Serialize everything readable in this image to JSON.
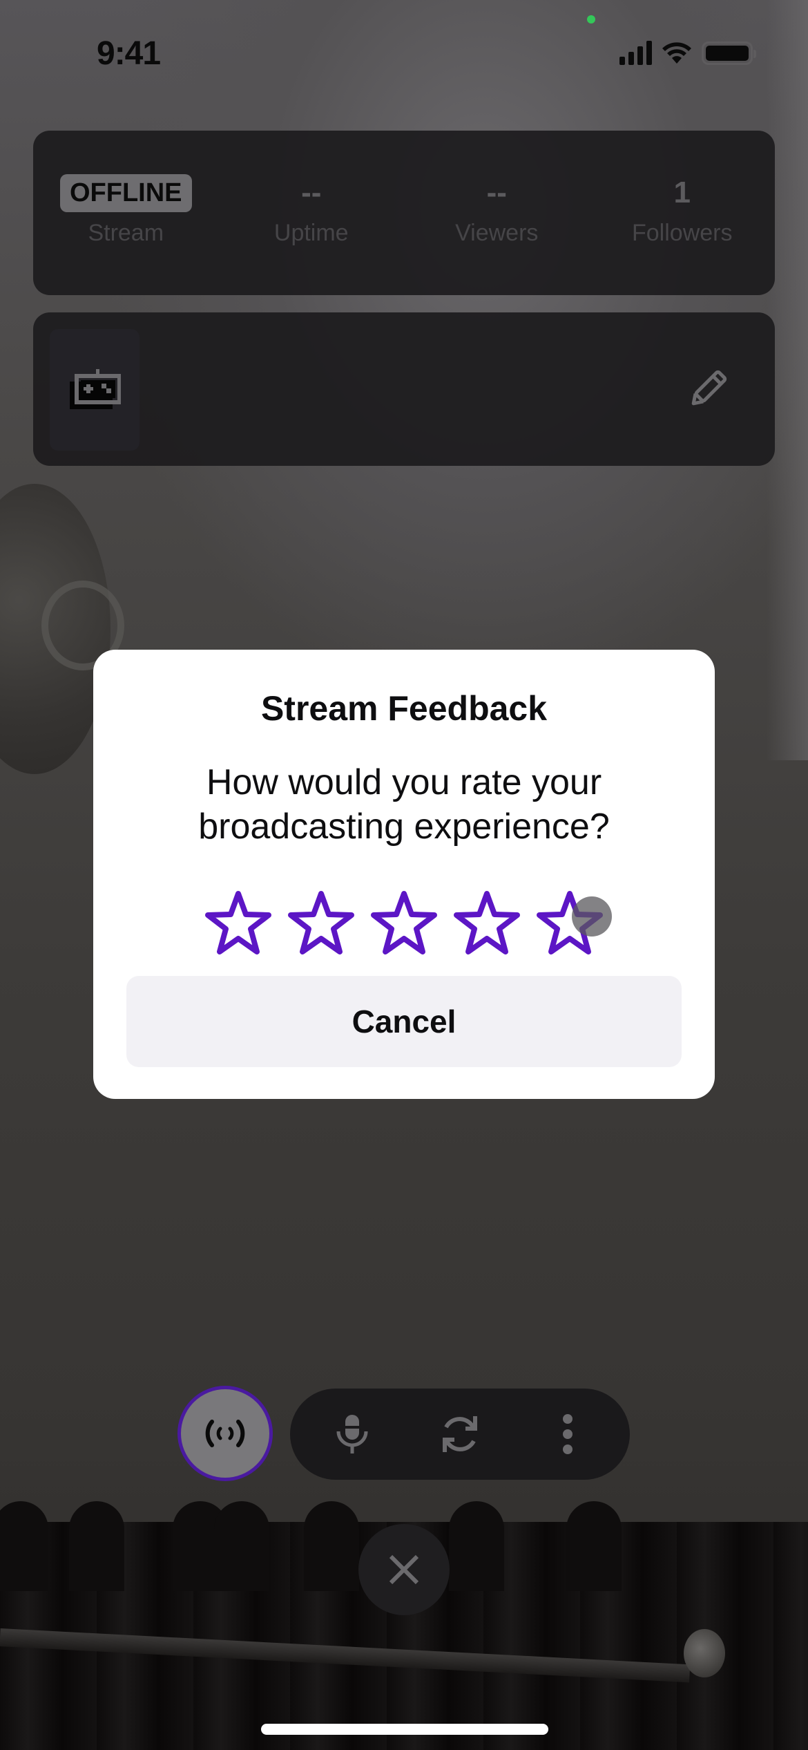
{
  "status_bar": {
    "time": "9:41",
    "icons": [
      "cellular-signal-icon",
      "wifi-icon",
      "battery-icon"
    ],
    "privacy_indicator_color": "#34c759"
  },
  "stats": {
    "items": [
      {
        "value": "OFFLINE",
        "label": "Stream",
        "is_badge": true
      },
      {
        "value": "--",
        "label": "Uptime"
      },
      {
        "value": "--",
        "label": "Viewers"
      },
      {
        "value": "1",
        "label": "Followers"
      }
    ]
  },
  "category": {
    "icon": "gamepad-icon",
    "edit_icon": "pencil-icon"
  },
  "feedback_modal": {
    "title": "Stream Feedback",
    "question": "How would you rate your broadcasting experience?",
    "rating": {
      "selected": 0,
      "max": 5
    },
    "star_color": "#5c16c5",
    "cancel_label": "Cancel"
  },
  "controls": {
    "go_live_icon": "broadcast-icon",
    "go_live_ring_color": "#4a1aa0",
    "mic_icon": "microphone-icon",
    "flip_camera_icon": "camera-flip-icon",
    "more_icon": "more-vertical-icon",
    "close_icon": "close-icon"
  }
}
